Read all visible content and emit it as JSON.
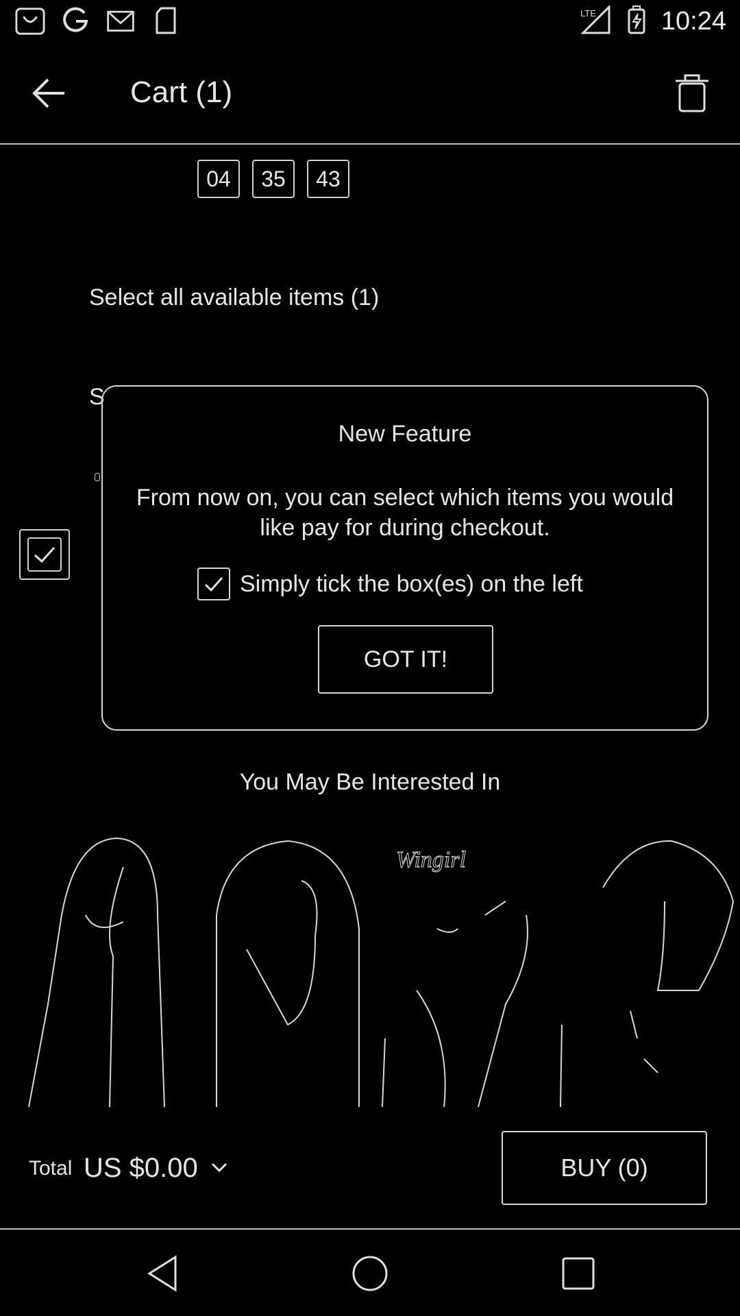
{
  "status_bar": {
    "time": "10:24",
    "network": "LTE",
    "icons": [
      "shopping-bag-icon",
      "google-icon",
      "gmail-icon",
      "sd-card-icon",
      "signal-icon",
      "battery-charging-icon"
    ]
  },
  "app_bar": {
    "title": "Cart (1)",
    "icons": [
      "back-arrow-icon",
      "trash-icon"
    ]
  },
  "timer": {
    "hours": "04",
    "minutes": "35",
    "seconds": "43"
  },
  "cart": {
    "select_all_label": "Select all available items (1)",
    "partial_text": "S"
  },
  "modal": {
    "title": "New Feature",
    "body": "From now on, you can select which items you would like pay for during checkout.",
    "hint": "Simply tick the box(es) on the left",
    "button_label": "GOT IT!"
  },
  "recommendations": {
    "heading": "You May Be Interested In",
    "brand_watermark": "Wingirl",
    "items": [
      "product-1",
      "product-2",
      "product-3",
      "product-4"
    ]
  },
  "footer": {
    "total_label": "Total",
    "total_value": "US $0.00",
    "buy_label": "BUY (0)"
  },
  "colors": {
    "background": "#000000",
    "outline": "#d8d8d8",
    "text": "#e6e6e6"
  }
}
